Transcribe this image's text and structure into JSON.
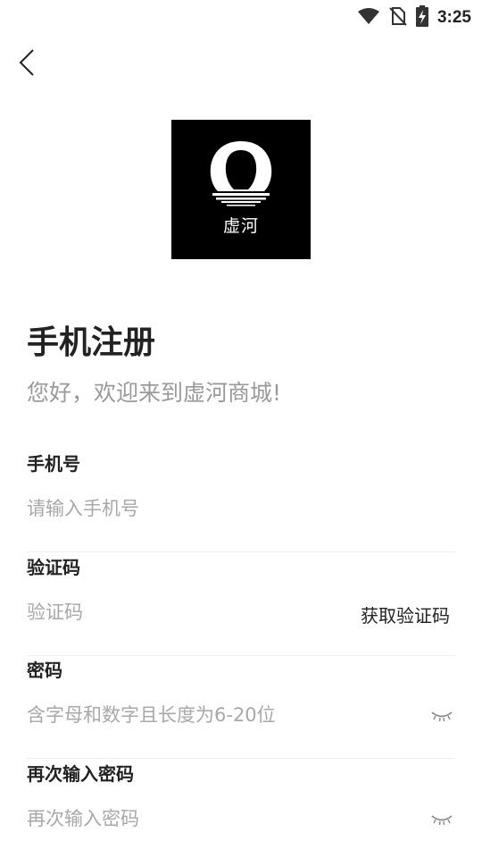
{
  "status_bar": {
    "time": "3:25"
  },
  "header": {
    "back_icon": "chevron-left-icon"
  },
  "logo": {
    "text": "虚河",
    "icon": "brand-logo-icon"
  },
  "page": {
    "title": "手机注册",
    "subtitle": "您好，欢迎来到虚河商城!"
  },
  "form": {
    "phone": {
      "label": "手机号",
      "placeholder": "请输入手机号",
      "value": ""
    },
    "code": {
      "label": "验证码",
      "placeholder": "验证码",
      "value": "",
      "action_label": "获取验证码"
    },
    "password": {
      "label": "密码",
      "placeholder": "含字母和数字且长度为6-20位",
      "value": "",
      "toggle_icon": "eye-closed-icon"
    },
    "confirm_password": {
      "label": "再次输入密码",
      "placeholder": "再次输入密码",
      "value": "",
      "toggle_icon": "eye-closed-icon"
    }
  },
  "colors": {
    "text_primary": "#222222",
    "text_placeholder": "#a8a8a8",
    "subtitle": "#9a9a9a",
    "divider": "#eeeeee",
    "logo_bg": "#000000"
  }
}
